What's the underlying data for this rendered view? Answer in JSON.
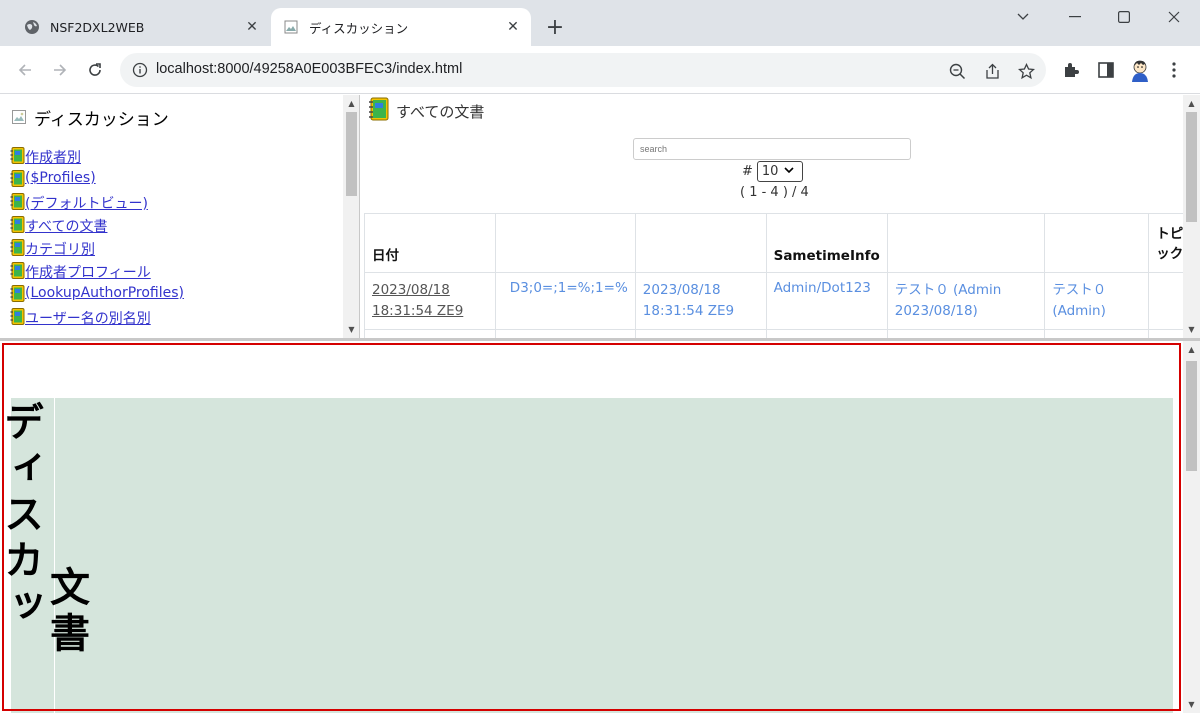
{
  "browser": {
    "tabs": [
      {
        "title": "NSF2DXL2WEB",
        "active": false,
        "favicon": "globe-icon"
      },
      {
        "title": "ディスカッション",
        "active": true,
        "favicon": "image-icon"
      }
    ],
    "url": "localhost:8000/49258A0E003BFEC3/index.html"
  },
  "left_frame": {
    "title": "ディスカッション",
    "views": [
      "作成者別",
      "($Profiles)",
      "(デフォルトビュー)",
      "すべての文書",
      "カテゴリ別",
      "作成者プロフィール",
      "(LookupAuthorProfiles)",
      "ユーザー名の別名別"
    ]
  },
  "right_frame": {
    "view_title": "すべての文書",
    "search_placeholder": "search",
    "page_size_prefix": "#",
    "page_size": "10",
    "range_text": "( 1 - 4 ) / 4",
    "columns": [
      "日付",
      "",
      "",
      "SametimeInfo",
      "",
      "",
      "トピック"
    ],
    "rows": [
      [
        "2023/08/18 18:31:54 ZE9",
        "D3;0=;1=%;1=%",
        "2023/08/18 18:31:54 ZE9",
        "Admin/Dot123",
        "テスト０ (Admin 2023/08/18)",
        "テスト０ (Admin)",
        ""
      ]
    ]
  },
  "bottom_frame": {
    "title_vertical": "ディスカッ",
    "subtitle_vertical": "文書"
  }
}
